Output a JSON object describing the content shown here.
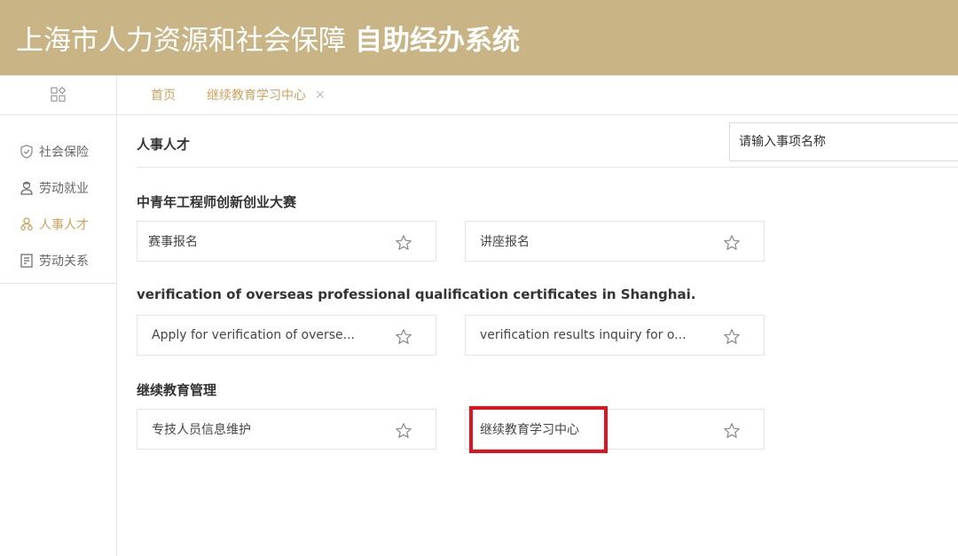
{
  "header": {
    "title_normal": "上海市人力资源和社会保障",
    "title_bold": "自助经办系统"
  },
  "sidebar": {
    "items": [
      {
        "label": "社会保险",
        "icon": "shield-icon",
        "active": false
      },
      {
        "label": "劳动就业",
        "icon": "worker-icon",
        "active": false
      },
      {
        "label": "人事人才",
        "icon": "people-icon",
        "active": true
      },
      {
        "label": "劳动关系",
        "icon": "contract-icon",
        "active": false
      }
    ]
  },
  "tabs": [
    {
      "label": "首页"
    },
    {
      "label": "继续教育学习中心",
      "closable": true
    }
  ],
  "tab_close": "×",
  "section": {
    "title": "人事人才",
    "search_placeholder": "请输入事项名称"
  },
  "groups": [
    {
      "title": "中青年工程师创新创业大赛",
      "cards": [
        "赛事报名",
        "讲座报名"
      ]
    },
    {
      "title": "verification of overseas professional qualification certificates in Shanghai.",
      "cards": [
        "Apply for verification of overse...",
        "verification results inquiry for o..."
      ]
    },
    {
      "title": "继续教育管理",
      "cards": [
        "专技人员信息维护",
        "继续教育学习中心"
      ]
    }
  ],
  "colors": {
    "header_bg": "#c9b486",
    "accent": "#c9a45f",
    "highlight": "#e0141e"
  }
}
